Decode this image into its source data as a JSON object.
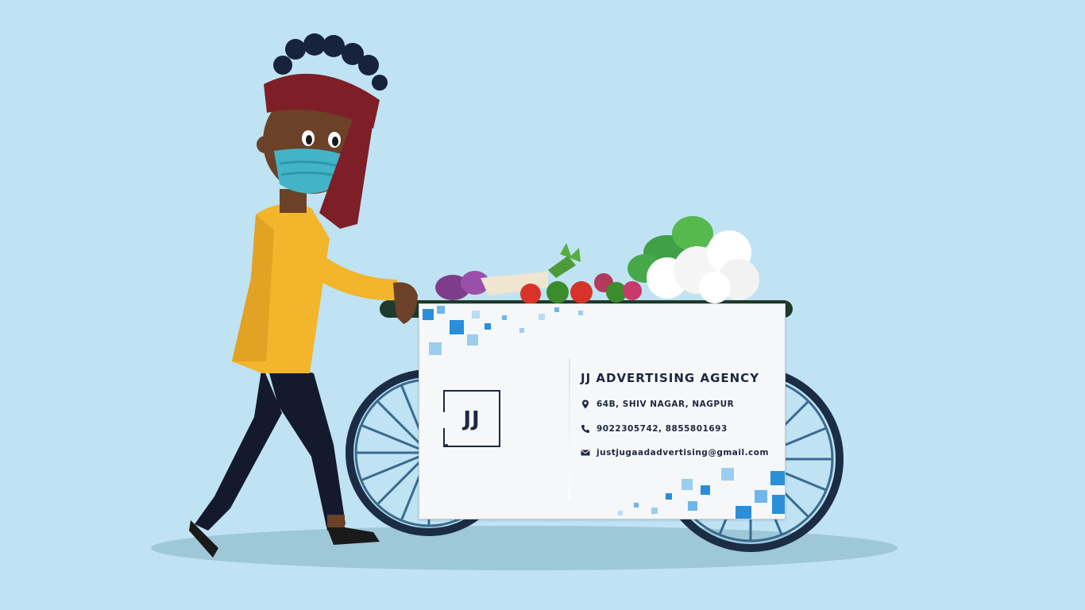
{
  "card": {
    "logo_text": "JJ",
    "company": "JJ ADVERTISING AGENCY",
    "address": "64B, SHIV NAGAR, NAGPUR",
    "phone": "9022305742, 8855801693",
    "email": "justjugaadadvertising@gmail.com",
    "icons": {
      "address": "location-pin-icon",
      "phone": "phone-icon",
      "email": "envelope-icon"
    }
  },
  "colors": {
    "background": "#bfe3f3",
    "shirt": "#f2b52b",
    "turban": "#7e1f28",
    "mask": "#43b4c8",
    "skin": "#6b4128",
    "pants": "#14192e",
    "wheel": "#1b2d45",
    "card_text": "#1d2740",
    "accent_blue": "#2a8fd9"
  }
}
